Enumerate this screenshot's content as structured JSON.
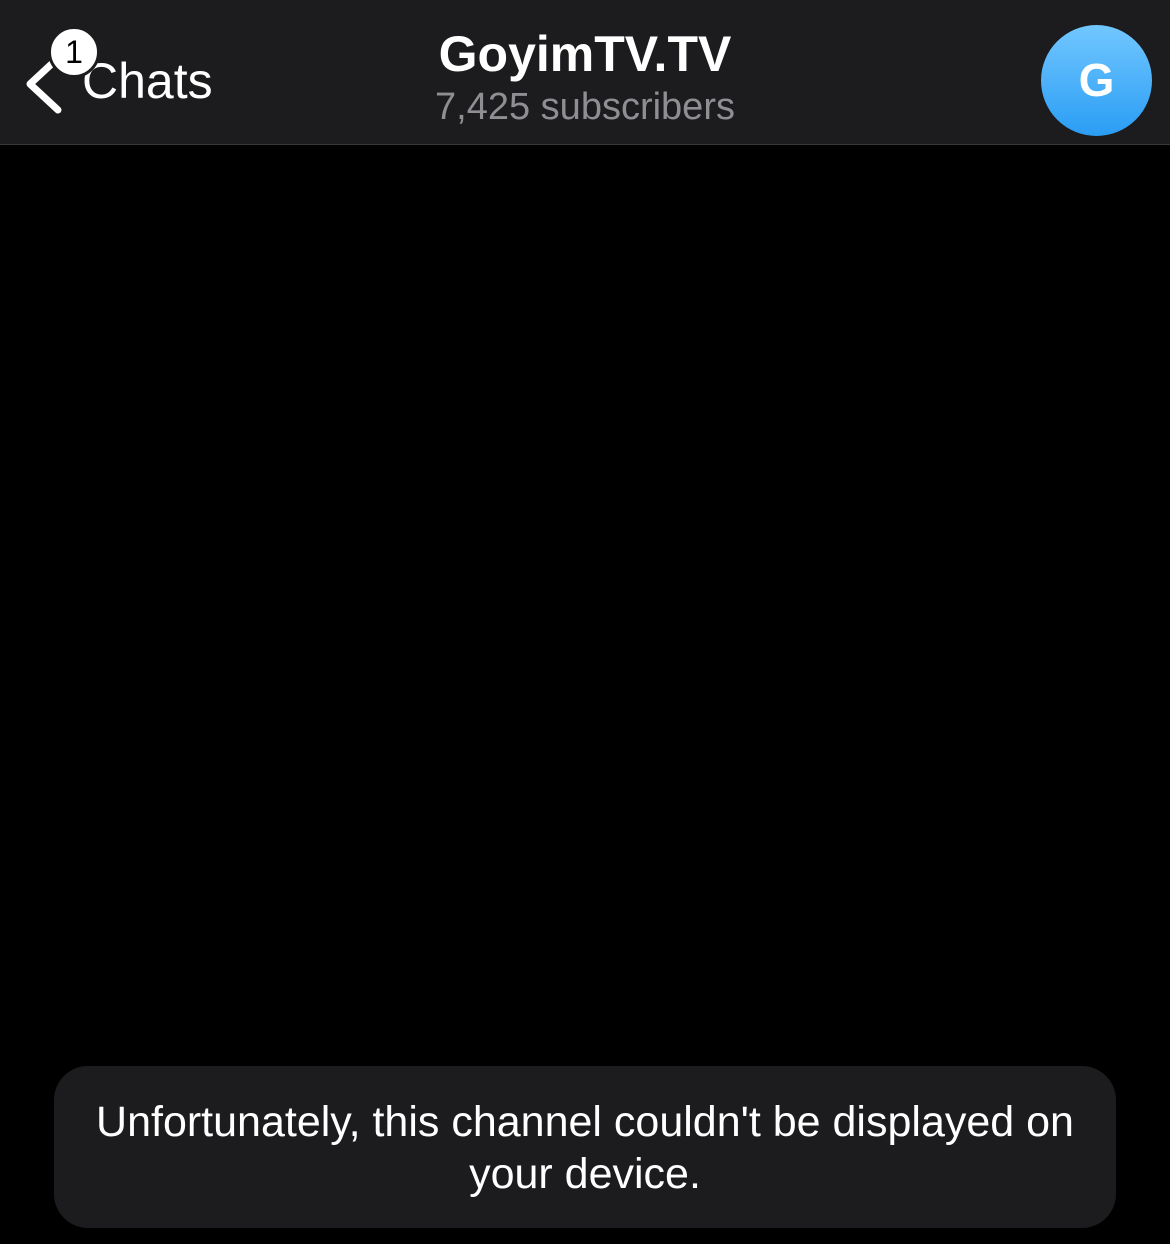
{
  "navbar": {
    "back_label": "Chats",
    "unread_count": "1",
    "title": "GoyimTV.TV",
    "subtitle": "7,425 subscribers",
    "avatar_initial": "G"
  },
  "notice": {
    "text": "Unfortunately, this channel couldn't be displayed on your device."
  },
  "colors": {
    "navbar_bg": "#1c1c1e",
    "background": "#000000",
    "subtitle": "#8e8e93",
    "avatar_top": "#72c7ff",
    "avatar_bottom": "#2a9df4"
  },
  "icons": {
    "back": "chevron-left-icon"
  }
}
